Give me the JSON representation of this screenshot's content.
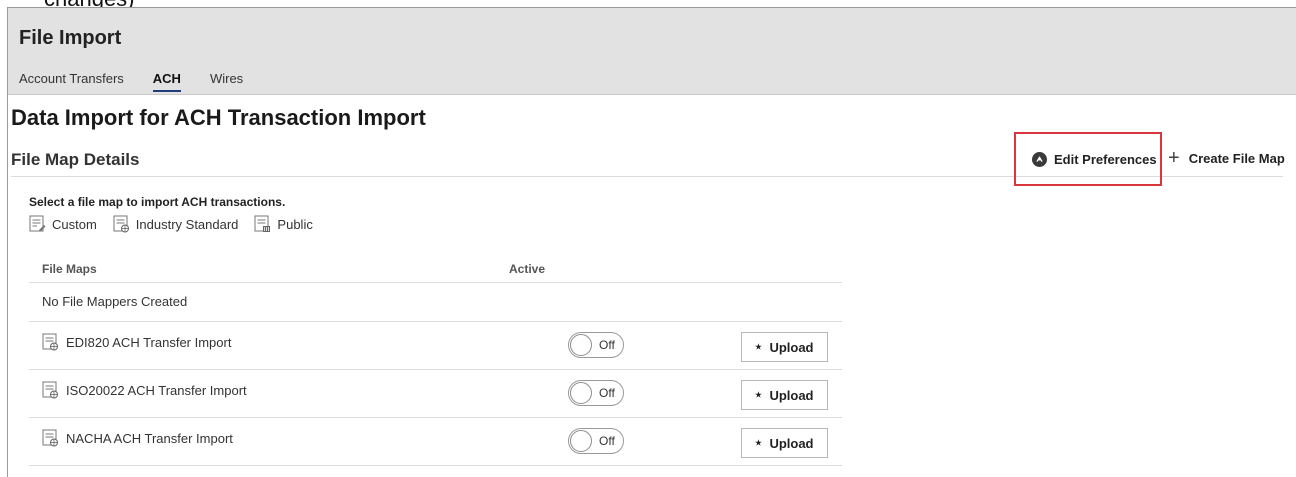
{
  "fragment_text": "changes)",
  "app": {
    "title": "File Import"
  },
  "tabs": [
    {
      "label": "Account Transfers",
      "active": false
    },
    {
      "label": "ACH",
      "active": true
    },
    {
      "label": "Wires",
      "active": false
    }
  ],
  "page": {
    "title": "Data Import for ACH Transaction Import",
    "section_title": "File Map Details",
    "instructions": "Select a file map to import ACH transactions."
  },
  "actions": {
    "edit_preferences": "Edit Preferences",
    "create_file_map": "Create File Map",
    "highlight_color": "#d9363e"
  },
  "legend": [
    {
      "label": "Custom",
      "icon": "custom-file-icon"
    },
    {
      "label": "Industry Standard",
      "icon": "industry-standard-file-icon"
    },
    {
      "label": "Public",
      "icon": "public-file-icon"
    }
  ],
  "table": {
    "columns": [
      "File Maps",
      "Active"
    ],
    "empty_message": "No File Mappers Created",
    "rows": [
      {
        "name": "EDI820 ACH Transfer Import",
        "toggle": "Off",
        "upload": "Upload"
      },
      {
        "name": "ISO20022 ACH Transfer Import",
        "toggle": "Off",
        "upload": "Upload"
      },
      {
        "name": "NACHA ACH Transfer Import",
        "toggle": "Off",
        "upload": "Upload"
      }
    ]
  }
}
